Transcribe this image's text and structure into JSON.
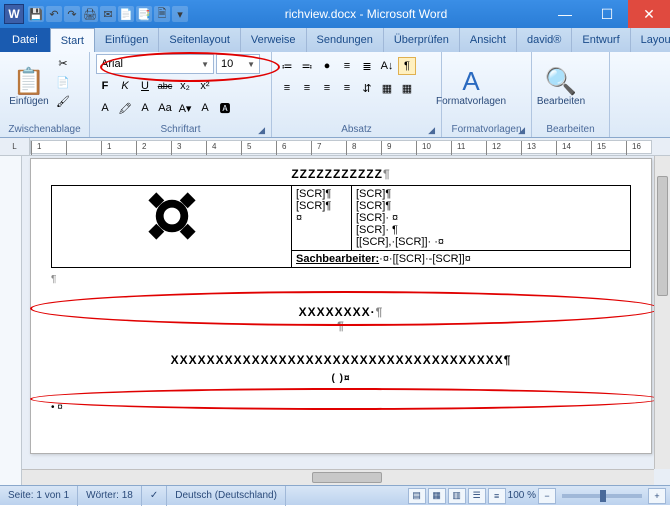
{
  "window": {
    "app_icon_letter": "W",
    "title": "richview.docx - Microsoft Word",
    "qat": [
      "💾",
      "↶",
      "↷",
      "🖨",
      "✉",
      "📄",
      "📑",
      "🗎",
      "🔍"
    ]
  },
  "tabs": {
    "file": "Datei",
    "items": [
      "Start",
      "Einfügen",
      "Seitenlayout",
      "Verweise",
      "Sendungen",
      "Überprüfen",
      "Ansicht",
      "david®",
      "Entwurf",
      "Layout"
    ],
    "active_index": 0
  },
  "ribbon": {
    "clipboard": {
      "label": "Zwischenablage",
      "paste": "Einfügen",
      "cut_icon": "✂",
      "copy_icon": "📄",
      "brush_icon": "🖌"
    },
    "font": {
      "label": "Schriftart",
      "name": "Arial",
      "size": "10",
      "bold": "F",
      "italic": "K",
      "underline": "U",
      "strike": "abc",
      "sub": "x₂",
      "sup": "x²",
      "row2": [
        "A",
        "🖍",
        "A",
        "Aa",
        "A▾",
        "A",
        "🅰"
      ]
    },
    "paragraph": {
      "label": "Absatz",
      "row1": [
        "≔",
        "≕",
        "⦁",
        "≡",
        "≣",
        "¶"
      ],
      "row2": [
        "≡",
        "≡",
        "≡",
        "≡",
        "⇵",
        "▦",
        "¶"
      ]
    },
    "styles": {
      "label": "Formatvorlagen",
      "btn": "Formatvorlagen",
      "icon": "A"
    },
    "editing": {
      "label": "Bearbeiten",
      "btn": "Bearbeiten",
      "icon": "🔍"
    }
  },
  "ruler": {
    "numbers": [
      "1",
      "",
      "1",
      "2",
      "3",
      "4",
      "5",
      "6",
      "7",
      "8",
      "9",
      "10",
      "11",
      "12",
      "13",
      "14",
      "15",
      "16"
    ]
  },
  "doc": {
    "line_z": "ZZZZZZZZZZZ",
    "scr1": "[SCR]¶",
    "scr2": "[SCR]¶",
    "currency": "¤",
    "right_lines": [
      "[SCR]¶",
      "[SCR]¶",
      "[SCR]· ¤",
      "[SCR]· ¶",
      "[[SCR],·[SCR]]· ·¤"
    ],
    "sach_label": "Sachbearbeiter:",
    "sach_value": "·¤·[[SCR]·-[SCR]]¤",
    "xline1": "XXXXXXXX·",
    "pil1": "¶",
    "xline2": "XXXXXXXXXXXXXXXXXXXXXXXXXXXXXXXXXXXXX¶",
    "paren_row": "(                                                                             )¤",
    "dot_row": "¤"
  },
  "status": {
    "page": "Seite: 1 von 1",
    "words": "Wörter: 18",
    "lang": "Deutsch (Deutschland)",
    "zoom": "100 %"
  }
}
